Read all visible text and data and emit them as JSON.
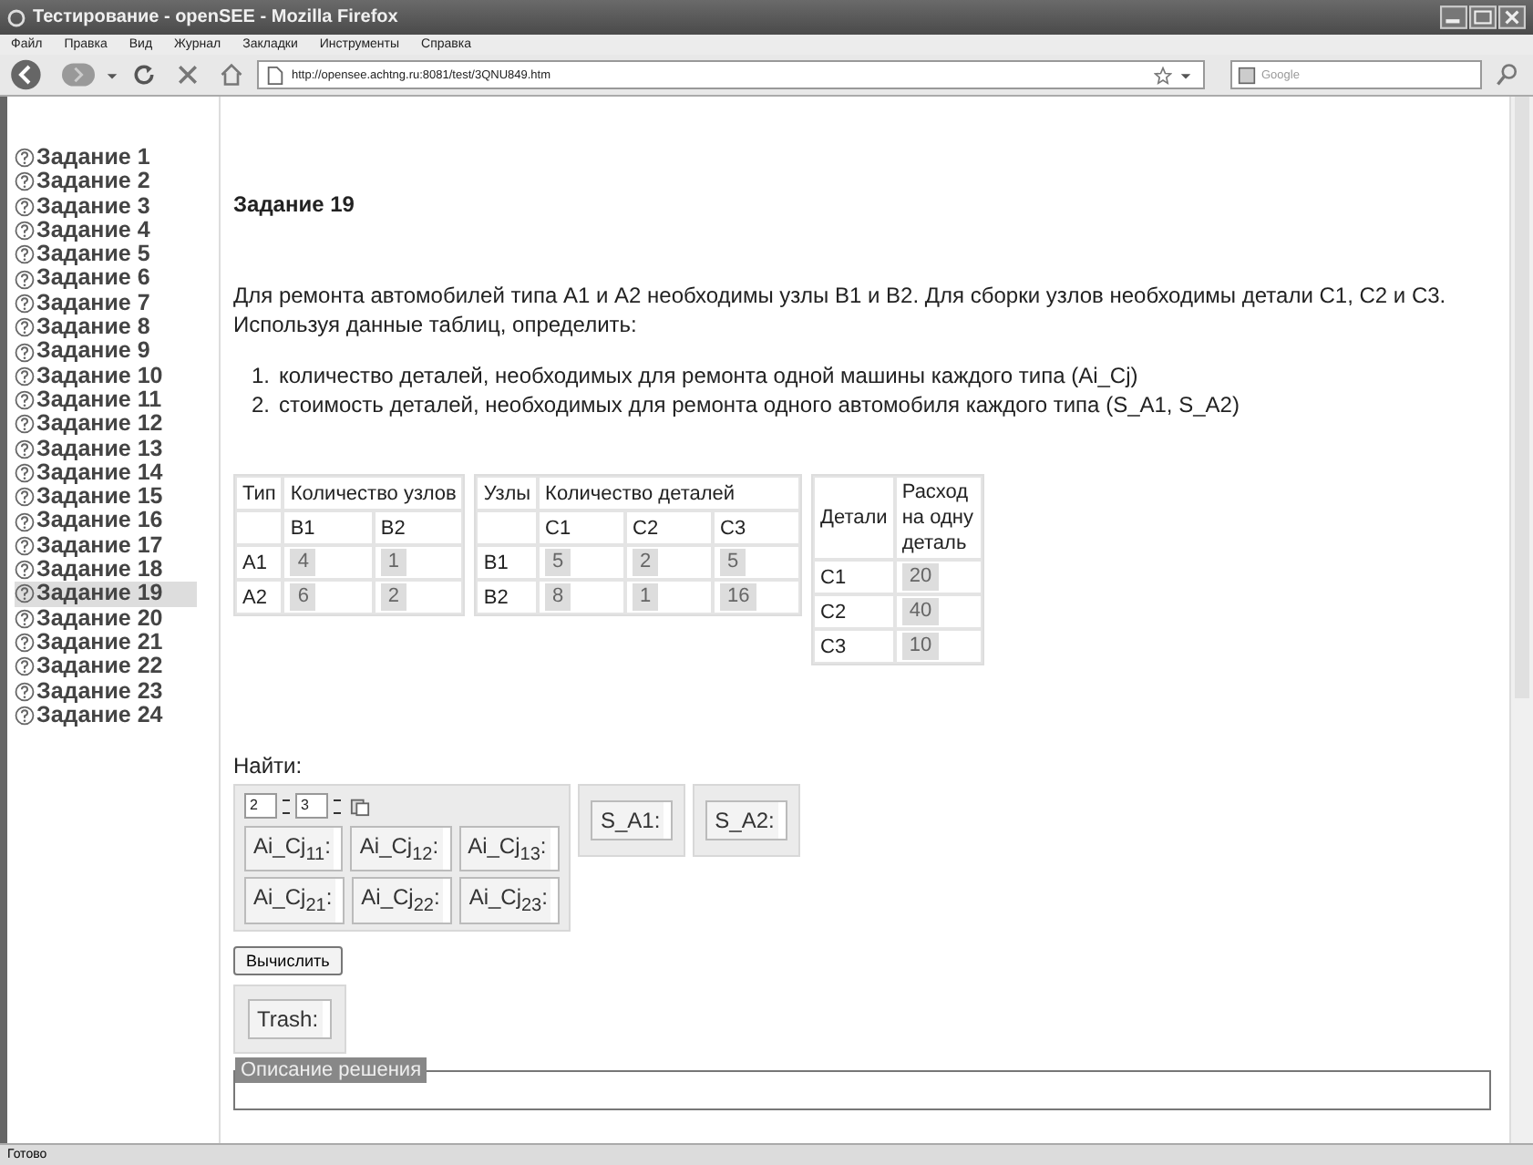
{
  "window": {
    "title": "Тестирование - openSEE - Mozilla Firefox"
  },
  "menu": [
    "Файл",
    "Правка",
    "Вид",
    "Журнал",
    "Закладки",
    "Инструменты",
    "Справка"
  ],
  "address": {
    "value": "http://opensee.achtng.ru:8081/test/3QNU849.htm"
  },
  "search": {
    "placeholder": "Google"
  },
  "sidebar": {
    "items": [
      {
        "label": "Задание 1",
        "selected": false
      },
      {
        "label": "Задание 2",
        "selected": false
      },
      {
        "label": "Задание 3",
        "selected": false
      },
      {
        "label": "Задание 4",
        "selected": false
      },
      {
        "label": "Задание 5",
        "selected": false
      },
      {
        "label": "Задание 6",
        "selected": false
      },
      {
        "label": "Задание 7",
        "selected": false
      },
      {
        "label": "Задание 8",
        "selected": false
      },
      {
        "label": "Задание 9",
        "selected": false
      },
      {
        "label": "Задание 10",
        "selected": false
      },
      {
        "label": "Задание 11",
        "selected": false
      },
      {
        "label": "Задание 12",
        "selected": false
      },
      {
        "label": "Задание 13",
        "selected": false
      },
      {
        "label": "Задание 14",
        "selected": false
      },
      {
        "label": "Задание 15",
        "selected": false
      },
      {
        "label": "Задание 16",
        "selected": false
      },
      {
        "label": "Задание 17",
        "selected": false
      },
      {
        "label": "Задание 18",
        "selected": false
      },
      {
        "label": "Задание 19",
        "selected": true
      },
      {
        "label": "Задание 20",
        "selected": false
      },
      {
        "label": "Задание 21",
        "selected": false
      },
      {
        "label": "Задание 22",
        "selected": false
      },
      {
        "label": "Задание 23",
        "selected": false
      },
      {
        "label": "Задание 24",
        "selected": false
      }
    ]
  },
  "task": {
    "title": "Задание 19",
    "text": "Для ремонта автомобилей типа A1 и A2 необходимы узлы B1 и B2. Для сборки узлов необходимы детали C1, C2 и C3. Используя данные таблиц, определить:",
    "steps": [
      {
        "number": "1.",
        "text": "количество деталей, необходимых для ремонта одной машины каждого типа (Ai_Cj)"
      },
      {
        "number": "2.",
        "text": "стоимость деталей, необходимых для ремонта одного автомобиля каждого типа (S_A1, S_A2)"
      }
    ]
  },
  "tables": [
    {
      "corner": "Тип",
      "group": "Количество узлов",
      "columns": [
        "B1",
        "B2"
      ],
      "rows": [
        {
          "label": "A1",
          "values": [
            "4",
            "1"
          ]
        },
        {
          "label": "A2",
          "values": [
            "6",
            "2"
          ]
        }
      ]
    },
    {
      "corner": "Узлы",
      "group": "Количество деталей",
      "columns": [
        "C1",
        "C2",
        "C3"
      ],
      "rows": [
        {
          "label": "B1",
          "values": [
            "5",
            "2",
            "5"
          ]
        },
        {
          "label": "B2",
          "values": [
            "8",
            "1",
            "16"
          ]
        }
      ]
    }
  ],
  "parts_table": {
    "corner": "Детали",
    "header": "Расход на одну деталь",
    "rows": [
      {
        "label": "C1",
        "value": "20"
      },
      {
        "label": "C2",
        "value": "40"
      },
      {
        "label": "C3",
        "value": "10"
      }
    ]
  },
  "find": {
    "label": "Найти:",
    "rows_value": "2",
    "cols_value": "3",
    "matrix": [
      [
        "Ai_Cj$_{11}$:",
        "Ai_Cj$_{12}$:",
        "Ai_Cj$_{13}$:"
      ],
      [
        "Ai_Cj$_{21}$:",
        "Ai_Cj$_{22}$:",
        "Ai_Cj$_{23}$:"
      ]
    ],
    "results": [
      "S_A1:",
      "S_A2:"
    ]
  },
  "compute_button": "Вычислить",
  "trash": "Trash:",
  "solution": {
    "legend": "Описание решения"
  },
  "status_bar": "Готово"
}
